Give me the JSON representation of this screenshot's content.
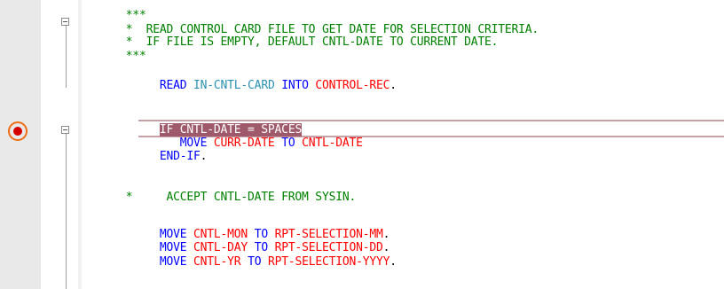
{
  "editor": {
    "breakpoint_icon": "breakpoint-icon",
    "fold_icon": "fold-collapse-icon",
    "lines": [
      {
        "indent": "      ",
        "parts": [
          {
            "t": "***",
            "c": "comment"
          }
        ]
      },
      {
        "indent": "      ",
        "parts": [
          {
            "t": "*  READ CONTROL CARD FILE TO GET DATE FOR SELECTION CRITERIA.",
            "c": "comment"
          }
        ]
      },
      {
        "indent": "      ",
        "parts": [
          {
            "t": "*  IF FILE IS EMPTY, DEFAULT CNTL-DATE TO CURRENT DATE.",
            "c": "comment"
          }
        ]
      },
      {
        "indent": "      ",
        "parts": [
          {
            "t": "***",
            "c": "comment"
          }
        ]
      },
      {
        "indent": "           ",
        "parts": [
          {
            "t": "READ ",
            "c": "key"
          },
          {
            "t": "IN-CNTL-CARD",
            "c": "teal"
          },
          {
            "t": " INTO ",
            "c": "key"
          },
          {
            "t": "CONTROL-REC",
            "c": "var"
          },
          {
            "t": ".",
            "c": "plain"
          }
        ]
      },
      {
        "indent": "",
        "parts": []
      },
      {
        "indent": "           ",
        "parts": [
          {
            "t": "IF CNTL-DATE = SPACES",
            "c": "hl"
          }
        ]
      },
      {
        "indent": "              ",
        "parts": [
          {
            "t": "MOVE ",
            "c": "key"
          },
          {
            "t": "CURR-DATE",
            "c": "var"
          },
          {
            "t": " TO ",
            "c": "key"
          },
          {
            "t": "CNTL-DATE",
            "c": "var"
          }
        ]
      },
      {
        "indent": "           ",
        "parts": [
          {
            "t": "END-IF",
            "c": "key"
          },
          {
            "t": ".",
            "c": "plain"
          }
        ]
      },
      {
        "indent": "",
        "parts": []
      },
      {
        "indent": "      ",
        "parts": [
          {
            "t": "*     ACCEPT CNTL-DATE FROM SYSIN.",
            "c": "comment"
          }
        ]
      },
      {
        "indent": "",
        "parts": []
      },
      {
        "indent": "           ",
        "parts": [
          {
            "t": "MOVE ",
            "c": "key"
          },
          {
            "t": "CNTL-MON",
            "c": "var"
          },
          {
            "t": " TO ",
            "c": "key"
          },
          {
            "t": "RPT-SELECTION-MM",
            "c": "var"
          },
          {
            "t": ".",
            "c": "plain"
          }
        ]
      },
      {
        "indent": "           ",
        "parts": [
          {
            "t": "MOVE ",
            "c": "key"
          },
          {
            "t": "CNTL-DAY",
            "c": "var"
          },
          {
            "t": " TO ",
            "c": "key"
          },
          {
            "t": "RPT-SELECTION-DD",
            "c": "var"
          },
          {
            "t": ".",
            "c": "plain"
          }
        ]
      },
      {
        "indent": "           ",
        "parts": [
          {
            "t": "MOVE ",
            "c": "key"
          },
          {
            "t": "CNTL-YR",
            "c": "var"
          },
          {
            "t": " TO ",
            "c": "key"
          },
          {
            "t": "RPT-SELECTION-YYYY",
            "c": "var"
          },
          {
            "t": ".",
            "c": "plain"
          }
        ]
      }
    ]
  }
}
